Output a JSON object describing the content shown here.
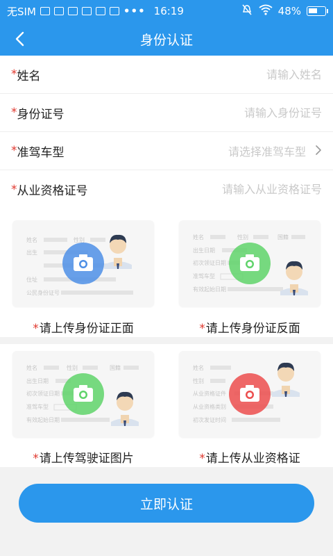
{
  "status_bar": {
    "carrier": "无SIM",
    "dots": "•••",
    "time": "16:19",
    "battery": "48%"
  },
  "header": {
    "title": "身份认证"
  },
  "form": {
    "required_mark": "*",
    "rows": [
      {
        "label": "姓名",
        "placeholder": "请输入姓名"
      },
      {
        "label": "身份证号",
        "placeholder": "请输入身份证号"
      },
      {
        "label": "准驾车型",
        "placeholder": "请选择准驾车型"
      },
      {
        "label": "从业资格证号",
        "placeholder": "请输入从业资格证号"
      }
    ]
  },
  "uploads": [
    {
      "label": "请上传身份证正面",
      "camera_color": "#4d8fe6",
      "card_fields": [
        "姓名",
        "性别",
        "出生",
        "住址",
        "公民身份证号"
      ]
    },
    {
      "label": "请上传身份证反面",
      "camera_color": "#5fd36a",
      "card_fields": [
        "姓名",
        "性别",
        "国籍",
        "出生日期",
        "初次领证日期",
        "准驾车型",
        "有效起始日期"
      ]
    },
    {
      "label": "请上传驾驶证图片",
      "camera_color": "#5fd36a",
      "card_fields": [
        "姓名",
        "性别",
        "国籍",
        "出生日期",
        "初次领证日期",
        "准驾车型",
        "有效起始日期"
      ]
    },
    {
      "label": "请上传从业资格证",
      "camera_color": "#ec4d4d",
      "card_fields": [
        "姓名",
        "性别",
        "从业资格证件",
        "从业资格类别",
        "初次发证时间"
      ]
    }
  ],
  "submit": {
    "label": "立即认证"
  },
  "colors": {
    "primary": "#2b97ec",
    "required": "#e0382f",
    "placeholder": "#c9c9c9"
  }
}
